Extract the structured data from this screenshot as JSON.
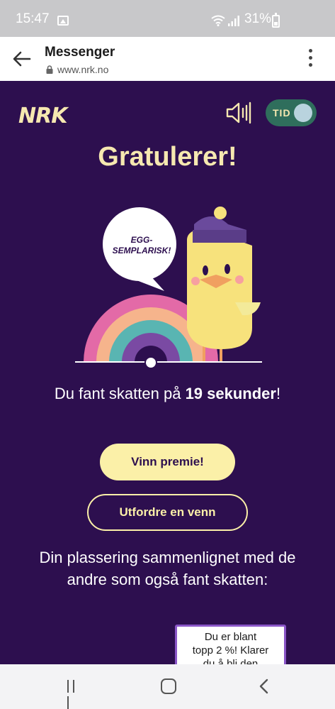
{
  "status_bar": {
    "time": "15:47",
    "battery_percent": "31%",
    "icons": [
      "image-icon",
      "wifi-icon",
      "signal-icon",
      "battery-icon"
    ]
  },
  "app_bar": {
    "title": "Messenger",
    "url": "www.nrk.no",
    "icons": [
      "back-arrow-icon",
      "lock-icon",
      "more-vert-icon"
    ]
  },
  "header": {
    "logo": "NRK",
    "toggle_label": "TID",
    "icons": [
      "speaker-icon"
    ]
  },
  "main": {
    "heading": "Gratulerer!",
    "speech_bubble_line1": "EGG-",
    "speech_bubble_line2": "SEMPLARISK!",
    "found_prefix": "Du fant skatten på ",
    "found_time": "19 sekunder",
    "found_suffix": "!",
    "prize_button": "Vinn premie!",
    "challenge_button": "Utfordre en venn",
    "placement_text": "Din plassering sammenlignet med de andre som også fant skatten:",
    "tooltip_line1": "Du er blant",
    "tooltip_line2": "topp 2 %! Klarer",
    "tooltip_line3": "du å bli den"
  },
  "colors": {
    "background": "#2d0f4f",
    "accent_yellow": "#fbf0a8",
    "toggle_green": "#2f6e5c"
  },
  "nav_bar": {
    "icons": [
      "recent-apps-icon",
      "home-icon",
      "back-icon"
    ]
  }
}
